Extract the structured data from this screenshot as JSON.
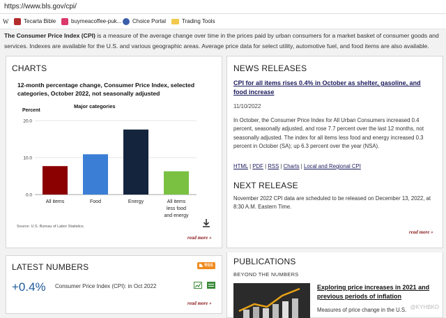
{
  "browser": {
    "url": "https://www.bls.gov/cpi/",
    "bookmarks": [
      {
        "label": "W",
        "icon": "wiki-icon"
      },
      {
        "label": "Tecarta Bible",
        "icon": "bible-icon"
      },
      {
        "label": "buymeacoffee-puk...",
        "icon": "coffee-icon"
      },
      {
        "label": "Choice Portal",
        "icon": "portal-icon"
      },
      {
        "label": "Trading Tools",
        "icon": "folder-icon"
      }
    ]
  },
  "intro": {
    "term": "The Consumer Price Index (CPI)",
    "text": " is a measure of the average change over time in the prices paid by urban consumers for a market basket of consumer goods and services. Indexes are available for the U.S. and various geographic areas. Average price data for select utility, automotive fuel, and food items are also available."
  },
  "charts": {
    "heading": "CHARTS",
    "read_more": "read more »",
    "download_icon": "download-icon"
  },
  "chart_data": {
    "type": "bar",
    "title": "12-month percentage change, Consumer Price Index, selected categories, October 2022, not seasonally adjusted",
    "subtitle": "Major categories",
    "ylabel": "Percent",
    "ylim": [
      0,
      20
    ],
    "yticks": [
      "0.0",
      "10.0",
      "20.0"
    ],
    "grid": true,
    "categories": [
      "All items",
      "Food",
      "Energy",
      "All items less food and energy"
    ],
    "category_lines": [
      [
        "All items"
      ],
      [
        "Food"
      ],
      [
        "Energy"
      ],
      [
        "All items",
        "less food",
        "and energy"
      ]
    ],
    "values": [
      7.7,
      10.9,
      17.6,
      6.3
    ],
    "colors": [
      "#8b0000",
      "#3a7fd5",
      "#14243d",
      "#7ac142"
    ],
    "source": "Source: U.S. Bureau of Labor Statistics."
  },
  "news": {
    "heading": "NEWS RELEASES",
    "headline": "CPI for all items rises 0.4% in October as shelter, gasoline, and food increase",
    "date": "11/10/2022",
    "body": "In October, the Consumer Price Index for All Urban Consumers increased 0.4 percent, seasonally adjusted, and rose 7.7 percent over the last 12 months, not seasonally adjusted. The index for all items less food and energy increased 0.3 percent in October (SA); up 6.3 percent over the year (NSA).",
    "links": [
      "HTML",
      "PDF",
      "RSS",
      "Charts",
      "Local and Regional CPI"
    ],
    "next_heading": "NEXT RELEASE",
    "next_body": "November 2022 CPI data are scheduled to be released on December 13, 2022, at 8:30 A.M. Eastern Time.",
    "read_more": "read more »"
  },
  "latest": {
    "heading": "LATEST NUMBERS",
    "rss_label": "RSS",
    "value": "+0.4%",
    "label": "Consumer Price Index (CPI): in Oct 2022",
    "read_more": "read more »"
  },
  "publications": {
    "heading": "PUBLICATIONS",
    "subheading": "BEYOND THE NUMBERS",
    "headline": "Exploring price increases in 2021 and previous periods of inflation",
    "body": "Measures of price change in the U.S.",
    "watermark": "@KYHBKO"
  }
}
